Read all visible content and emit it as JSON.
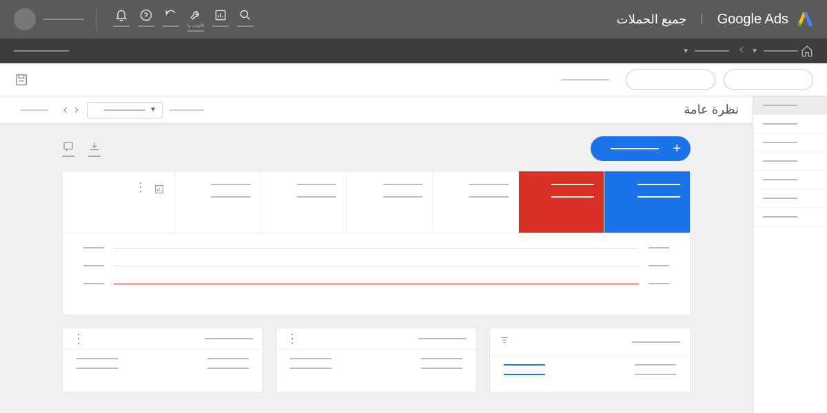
{
  "brand": "Google Ads",
  "campaigns_label": "جميع الحملات",
  "tab_title": "نظرة عامة",
  "icons": {
    "tools": "الأدوات والإعدادات"
  },
  "sidebar": {
    "items": [
      {
        "active": true
      },
      {},
      {},
      {},
      {},
      {},
      {}
    ]
  },
  "metrics": [
    {
      "c": "blue"
    },
    {
      "c": "red"
    },
    {},
    {},
    {},
    {},
    {
      "last": true
    }
  ],
  "chart_rows": [
    {
      "red": false
    },
    {
      "red": false
    },
    {
      "red": true
    }
  ],
  "cards": [
    {
      "filter": true,
      "rows": [
        [
          "blue"
        ],
        [
          "blue"
        ]
      ]
    },
    {
      "rows": [
        [
          ""
        ],
        [
          ""
        ]
      ]
    },
    {
      "rows": [
        [
          ""
        ],
        [
          ""
        ]
      ]
    }
  ]
}
